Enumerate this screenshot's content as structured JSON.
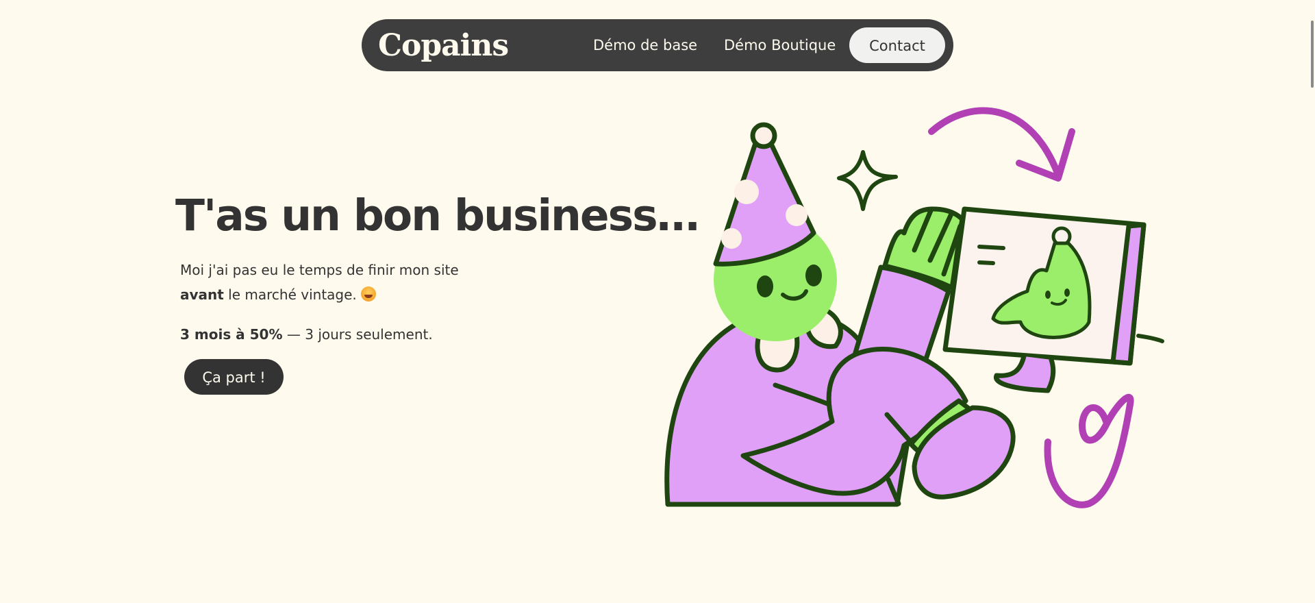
{
  "nav": {
    "logo": "Copains",
    "links": [
      {
        "label": "Démo de base"
      },
      {
        "label": "Démo Boutique"
      }
    ],
    "contact_label": "Contact"
  },
  "hero": {
    "title": "T'as un bon business…",
    "desc_line1": "Moi j'ai pas eu le temps de finir mon site",
    "desc_bold": "avant",
    "desc_line2_rest": " le marché vintage.",
    "offer_bold": "3 mois à 50%",
    "offer_rest": " — 3 jours seulement.",
    "cta_label": "Ça part !"
  },
  "colors": {
    "background": "#fefaee",
    "nav_bg": "#3e3e3e",
    "text": "#333333",
    "accent_green": "#9bee6a",
    "accent_purple": "#e1a0f8",
    "accent_magenta": "#b140b4",
    "outline": "#1f4610"
  },
  "icons": {
    "emoji": "sweat-smile-emoji",
    "illustration": "party-character-at-computer"
  }
}
